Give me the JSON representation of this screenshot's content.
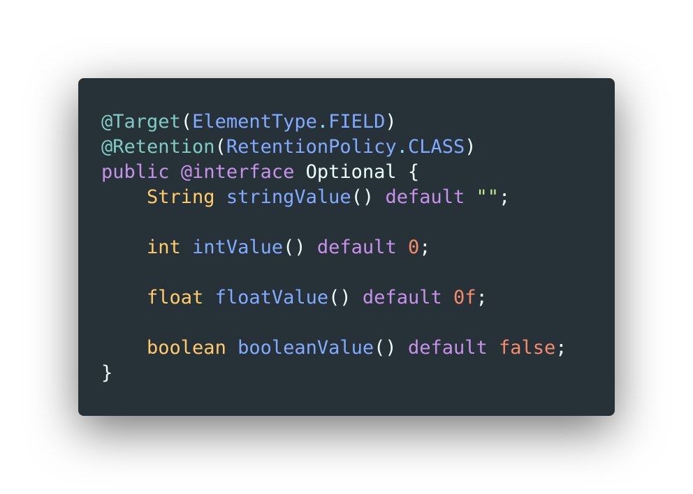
{
  "colors": {
    "background": "#ffffff",
    "editor_background": "#263238",
    "default_text": "#eeffff",
    "annotation": "#80cbc4",
    "type_ref": "#82aaff",
    "keyword": "#c792ea",
    "primitive": "#ffcb6b",
    "method": "#82aaff",
    "string": "#c3e88d",
    "number": "#f78c6c",
    "punctuation": "#89ddff",
    "paren": "#eeffff"
  },
  "code": {
    "language": "java",
    "lines": [
      [
        {
          "text": "@Target",
          "kind": "annotation"
        },
        {
          "text": "(",
          "kind": "paren"
        },
        {
          "text": "ElementType",
          "kind": "type_ref"
        },
        {
          "text": ".",
          "kind": "punctuation"
        },
        {
          "text": "FIELD",
          "kind": "type_ref"
        },
        {
          "text": ")",
          "kind": "paren"
        }
      ],
      [
        {
          "text": "@Retention",
          "kind": "annotation"
        },
        {
          "text": "(",
          "kind": "paren"
        },
        {
          "text": "RetentionPolicy",
          "kind": "type_ref"
        },
        {
          "text": ".",
          "kind": "punctuation"
        },
        {
          "text": "CLASS",
          "kind": "type_ref"
        },
        {
          "text": ")",
          "kind": "paren"
        }
      ],
      [
        {
          "text": "public",
          "kind": "keyword"
        },
        {
          "text": " ",
          "kind": "default_text"
        },
        {
          "text": "@interface",
          "kind": "keyword"
        },
        {
          "text": " Optional {",
          "kind": "default_text"
        }
      ],
      [
        {
          "text": "    ",
          "kind": "default_text"
        },
        {
          "text": "String",
          "kind": "primitive"
        },
        {
          "text": " ",
          "kind": "default_text"
        },
        {
          "text": "stringValue",
          "kind": "method"
        },
        {
          "text": "()",
          "kind": "paren"
        },
        {
          "text": " ",
          "kind": "default_text"
        },
        {
          "text": "default",
          "kind": "keyword"
        },
        {
          "text": " ",
          "kind": "default_text"
        },
        {
          "text": "\"\"",
          "kind": "string"
        },
        {
          "text": ";",
          "kind": "default_text"
        }
      ],
      [],
      [
        {
          "text": "    ",
          "kind": "default_text"
        },
        {
          "text": "int",
          "kind": "primitive"
        },
        {
          "text": " ",
          "kind": "default_text"
        },
        {
          "text": "intValue",
          "kind": "method"
        },
        {
          "text": "()",
          "kind": "paren"
        },
        {
          "text": " ",
          "kind": "default_text"
        },
        {
          "text": "default",
          "kind": "keyword"
        },
        {
          "text": " ",
          "kind": "default_text"
        },
        {
          "text": "0",
          "kind": "number"
        },
        {
          "text": ";",
          "kind": "default_text"
        }
      ],
      [],
      [
        {
          "text": "    ",
          "kind": "default_text"
        },
        {
          "text": "float",
          "kind": "primitive"
        },
        {
          "text": " ",
          "kind": "default_text"
        },
        {
          "text": "floatValue",
          "kind": "method"
        },
        {
          "text": "()",
          "kind": "paren"
        },
        {
          "text": " ",
          "kind": "default_text"
        },
        {
          "text": "default",
          "kind": "keyword"
        },
        {
          "text": " ",
          "kind": "default_text"
        },
        {
          "text": "0f",
          "kind": "number"
        },
        {
          "text": ";",
          "kind": "default_text"
        }
      ],
      [],
      [
        {
          "text": "    ",
          "kind": "default_text"
        },
        {
          "text": "boolean",
          "kind": "primitive"
        },
        {
          "text": " ",
          "kind": "default_text"
        },
        {
          "text": "booleanValue",
          "kind": "method"
        },
        {
          "text": "()",
          "kind": "paren"
        },
        {
          "text": " ",
          "kind": "default_text"
        },
        {
          "text": "default",
          "kind": "keyword"
        },
        {
          "text": " ",
          "kind": "default_text"
        },
        {
          "text": "false",
          "kind": "number"
        },
        {
          "text": ";",
          "kind": "default_text"
        }
      ],
      [
        {
          "text": "}",
          "kind": "default_text"
        }
      ]
    ]
  }
}
